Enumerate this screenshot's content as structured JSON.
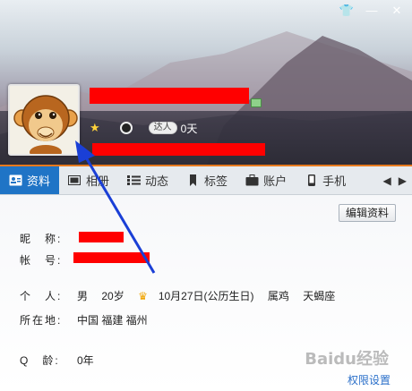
{
  "window": {
    "controls": [
      "shirt-icon",
      "minimize-icon",
      "close-icon"
    ]
  },
  "profile": {
    "level_days": "0天",
    "daren_label": "达人"
  },
  "tabs": [
    {
      "label": "资料",
      "icon": "profile-card-icon",
      "active": true
    },
    {
      "label": "相册",
      "icon": "photo-album-icon",
      "active": false
    },
    {
      "label": "动态",
      "icon": "feed-list-icon",
      "active": false
    },
    {
      "label": "标签",
      "icon": "bookmark-icon",
      "active": false
    },
    {
      "label": "账户",
      "icon": "briefcase-icon",
      "active": false
    },
    {
      "label": "手机",
      "icon": "mobile-phone-icon",
      "active": false
    }
  ],
  "content": {
    "edit_button": "编辑资料",
    "nickname_label": "昵　称:",
    "account_label": "帐　号:",
    "personal_label": "个　人:",
    "personal": {
      "gender": "男",
      "age": "20岁",
      "birthday": "10月27日(公历生日)",
      "zodiac": "属鸡",
      "star_sign": "天蝎座"
    },
    "location_label": "所在地:",
    "location": "中国 福建 福州",
    "qage_label": "Q　龄:",
    "qage": "0年",
    "permission_link": "权限设置",
    "watermark": "Baidu经验"
  },
  "colors": {
    "accent_blue": "#1f74c6",
    "orange_line": "#e77a1e",
    "redaction": "#ff0000",
    "arrow": "#1a3fd6"
  }
}
